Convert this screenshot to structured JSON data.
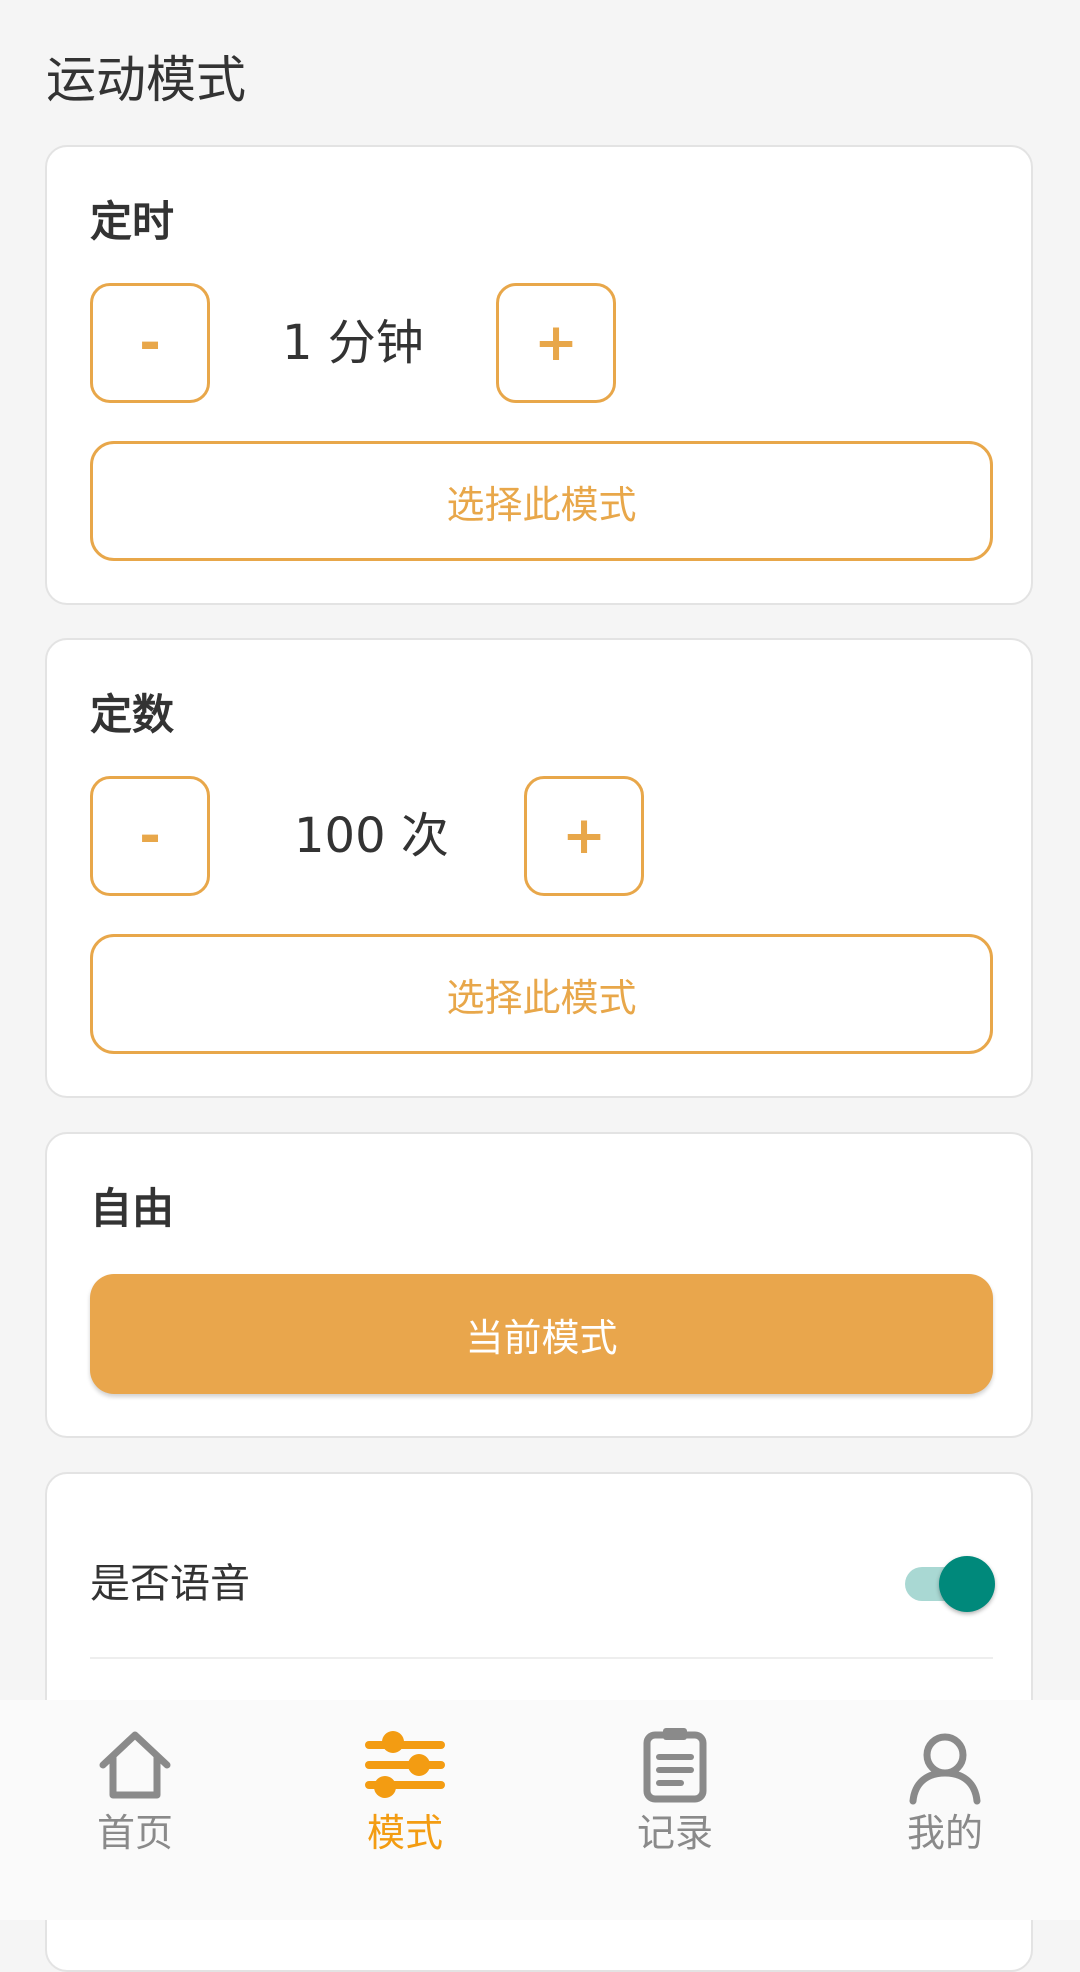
{
  "page": {
    "title": "运动模式"
  },
  "timer_card": {
    "title": "定时",
    "minus_label": "-",
    "value": "1 分钟",
    "plus_label": "+",
    "select_label": "选择此模式"
  },
  "count_card": {
    "title": "定数",
    "minus_label": "-",
    "value": "100 次",
    "plus_label": "+",
    "select_label": "选择此模式"
  },
  "free_card": {
    "title": "自由",
    "current_label": "当前模式"
  },
  "settings_card": {
    "voice_label": "是否语音",
    "voice_enabled": true
  },
  "tabbar": {
    "tabs": [
      {
        "label": "首页",
        "icon": "home-icon",
        "active": false
      },
      {
        "label": "模式",
        "icon": "sliders-icon",
        "active": true
      },
      {
        "label": "记录",
        "icon": "clipboard-icon",
        "active": false
      },
      {
        "label": "我的",
        "icon": "user-icon",
        "active": false
      }
    ]
  },
  "colors": {
    "accent": "#e8a74a",
    "accent_fill": "#e9a64c",
    "tab_active": "#f39c12",
    "tab_inactive": "#8a8a8a",
    "toggle_on": "#00897b",
    "toggle_track": "#a9d8d3",
    "background": "#f5f5f5"
  }
}
